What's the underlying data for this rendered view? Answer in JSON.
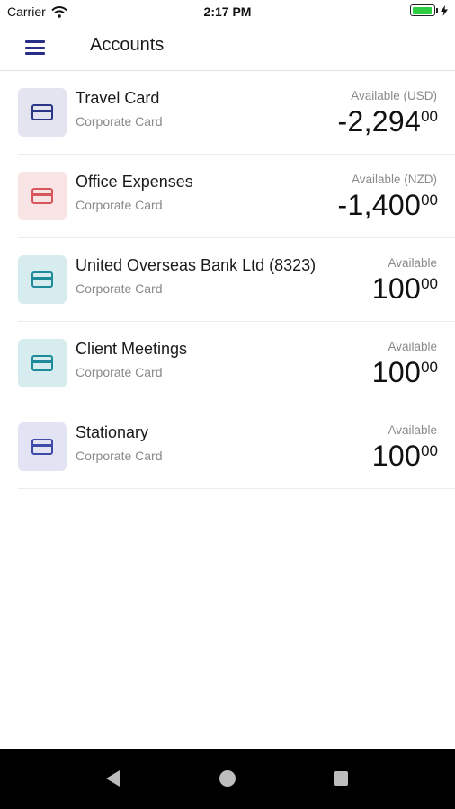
{
  "status_bar": {
    "carrier": "Carrier",
    "time": "2:17 PM"
  },
  "nav": {
    "title": "Accounts",
    "menu_icon": "hamburger-menu-icon"
  },
  "accounts": [
    {
      "name": "Travel Card",
      "subtitle": "Corporate Card",
      "available_label": "Available (USD)",
      "amount": "-2,294",
      "cents": "00",
      "icon": "credit-card-icon",
      "tile_color": "#e3e4ef",
      "icon_color": "#2c3686"
    },
    {
      "name": "Office Expenses",
      "subtitle": "Corporate Card",
      "available_label": "Available (NZD)",
      "amount": "-1,400",
      "cents": "00",
      "icon": "credit-card-icon",
      "tile_color": "#f8e4e5",
      "icon_color": "#d9555c"
    },
    {
      "name": "United Overseas Bank Ltd (8323)",
      "subtitle": "Corporate Card",
      "available_label": "Available",
      "amount": "100",
      "cents": "00",
      "icon": "credit-card-icon",
      "tile_color": "#d7ecef",
      "icon_color": "#1e8a9a"
    },
    {
      "name": "Client Meetings",
      "subtitle": "Corporate Card",
      "available_label": "Available",
      "amount": "100",
      "cents": "00",
      "icon": "credit-card-icon",
      "tile_color": "#d7ecef",
      "icon_color": "#1e8a9a"
    },
    {
      "name": "Stationary",
      "subtitle": "Corporate Card",
      "available_label": "Available",
      "amount": "100",
      "cents": "00",
      "icon": "credit-card-icon",
      "tile_color": "#e3e4f3",
      "icon_color": "#3f49a8"
    }
  ],
  "system_nav": {
    "back_icon": "back-triangle-icon",
    "home_icon": "home-circle-icon",
    "recent_icon": "recents-square-icon"
  }
}
